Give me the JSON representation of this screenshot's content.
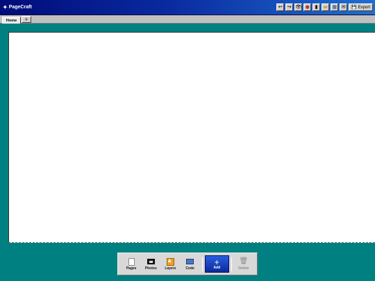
{
  "app": {
    "logo_glyph": "✦",
    "title": "PageCraft"
  },
  "toolbar": {
    "buttons": [
      {
        "name": "undo",
        "glyph": "↩"
      },
      {
        "name": "redo",
        "glyph": "↪"
      },
      {
        "name": "preview",
        "glyph": "👁"
      },
      {
        "name": "color",
        "glyph": "●"
      },
      {
        "name": "mobile",
        "glyph": "▮"
      },
      {
        "name": "folder",
        "glyph": "▬"
      },
      {
        "name": "grid",
        "glyph": "▦"
      },
      {
        "name": "mail",
        "glyph": "✉"
      }
    ],
    "export_glyph": "💾",
    "export_label": "Export"
  },
  "tabs": {
    "items": [
      {
        "label": "Home"
      }
    ],
    "add_glyph": "+"
  },
  "dock": {
    "pages_label": "Pages",
    "photos_label": "Photos",
    "layers_label": "Layers",
    "layers_glyph": "♟",
    "code_label": "Code",
    "add_glyph": "+",
    "add_label": "Add",
    "delete_glyph": "🗑",
    "delete_label": "Delete"
  },
  "colors": {
    "desktop": "#008080",
    "titlebar_start": "#000c7a",
    "titlebar_end": "#1f6fd0",
    "add_button": "#0a2a9a"
  }
}
